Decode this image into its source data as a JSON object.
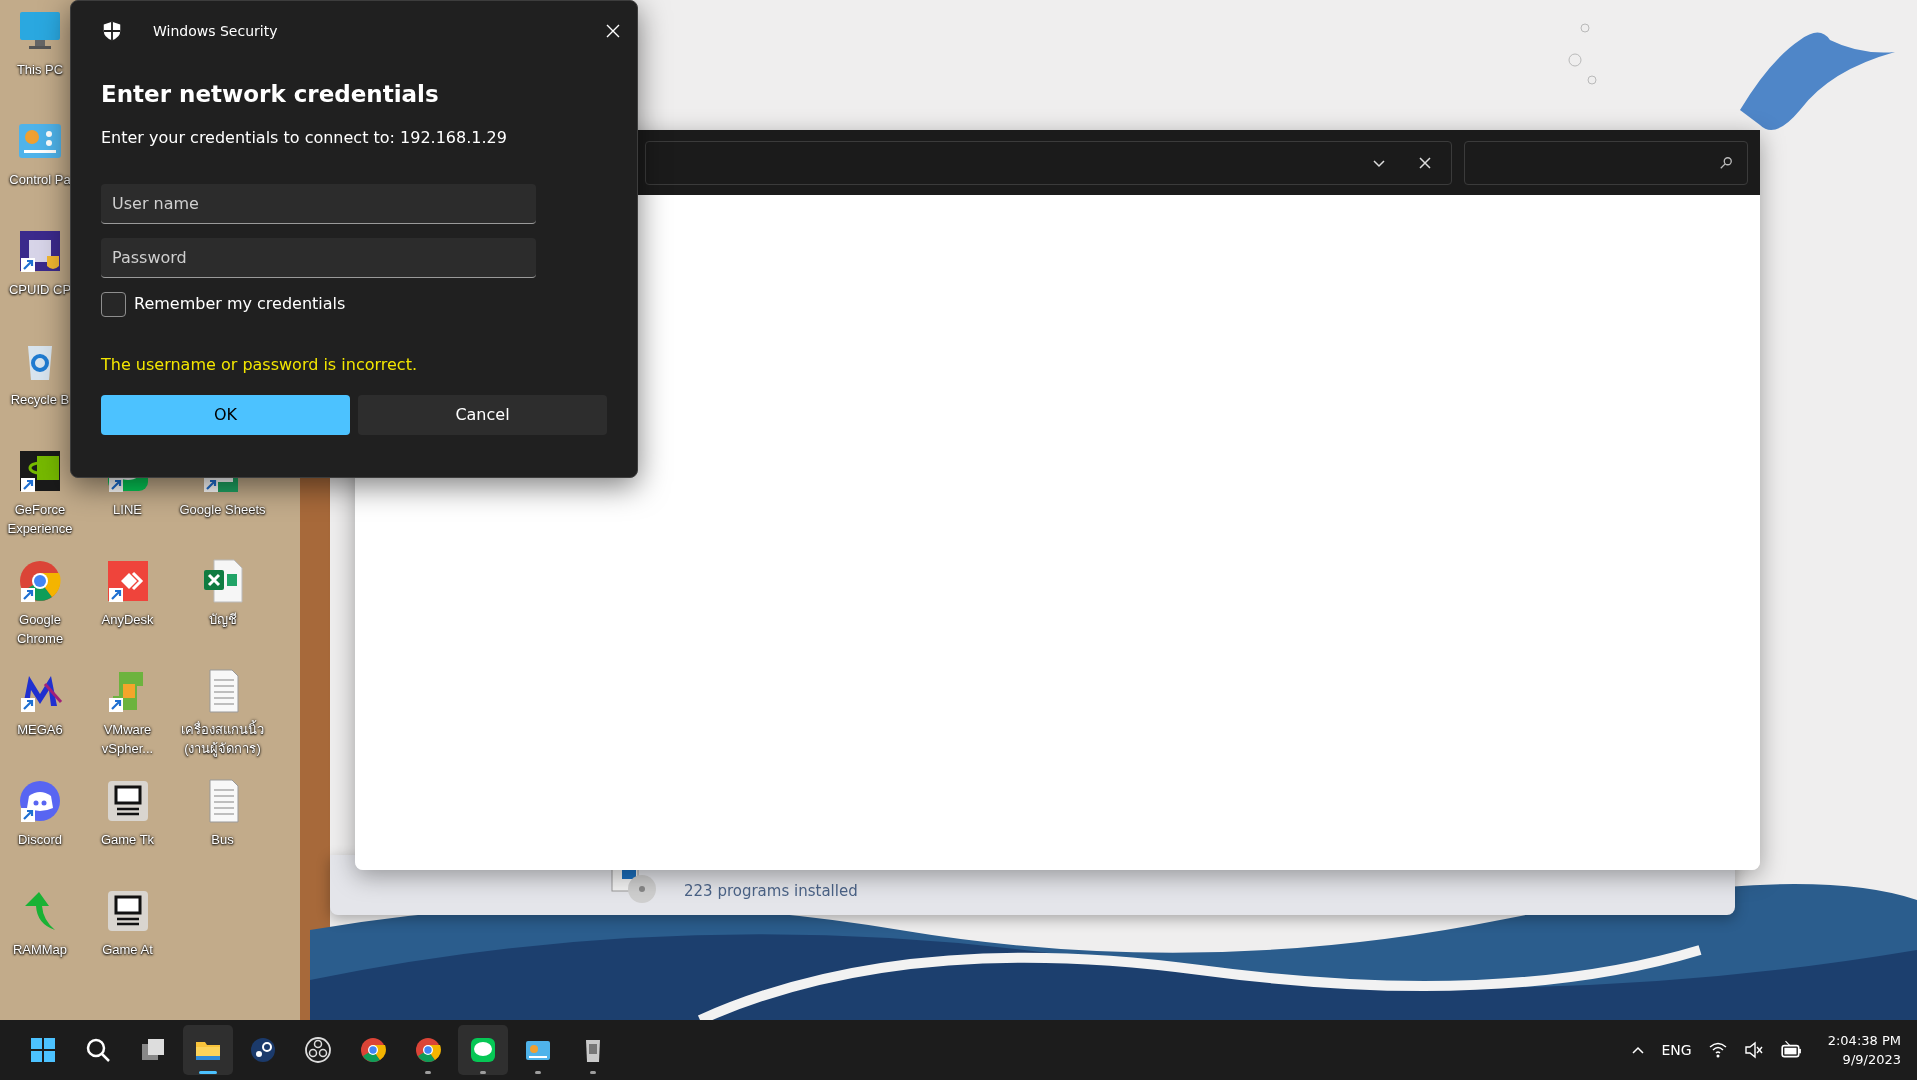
{
  "desktop_columns": [
    [
      {
        "label": "This PC",
        "kind": "monitor",
        "shortcut": false
      },
      {
        "label": "Control Pa",
        "kind": "control-panel",
        "shortcut": false
      },
      {
        "label": "CPUID CP",
        "kind": "chip",
        "shortcut": true
      },
      {
        "label": "Recycle B",
        "kind": "recycle",
        "shortcut": false
      },
      {
        "label": "GeForce Experience",
        "kind": "geforce",
        "shortcut": true
      },
      {
        "label": "Google Chrome",
        "kind": "chrome",
        "shortcut": true
      },
      {
        "label": "MEGA6",
        "kind": "mega",
        "shortcut": true
      },
      {
        "label": "Discord",
        "kind": "discord",
        "shortcut": true
      },
      {
        "label": "RAMMap",
        "kind": "arrow",
        "shortcut": false
      }
    ],
    [
      {
        "label": "LINE",
        "kind": "line",
        "shortcut": true
      },
      {
        "label": "AnyDesk",
        "kind": "anydesk",
        "shortcut": true
      },
      {
        "label": "VMware vSpher...",
        "kind": "vmware",
        "shortcut": true
      },
      {
        "label": "Game Tk",
        "kind": "terminal",
        "shortcut": false
      },
      {
        "label": "Game At",
        "kind": "terminal",
        "shortcut": false
      }
    ],
    [
      {
        "label": "Google Sheets",
        "kind": "sheets",
        "shortcut": true
      },
      {
        "label": "บัญชี",
        "kind": "excel",
        "shortcut": false
      },
      {
        "label": "เครื่องสแกนนิ้ว (งานผู้จัดการ)",
        "kind": "document",
        "shortcut": false
      },
      {
        "label": "Bus",
        "kind": "document",
        "shortcut": false
      }
    ]
  ],
  "dialog": {
    "app_title": "Windows Security",
    "heading": "Enter network credentials",
    "prompt": "Enter your credentials to connect to: 192.168.1.29",
    "fields": [
      {
        "placeholder": "User name"
      },
      {
        "placeholder": "Password"
      }
    ],
    "remember": {
      "label": "Remember my credentials",
      "checked": false
    },
    "error": "The username or password is incorrect.",
    "buttons": [
      {
        "label": "OK",
        "primary": true
      },
      {
        "label": "Cancel",
        "primary": false
      }
    ]
  },
  "explorer": {
    "status": "223 programs installed"
  },
  "taskbar": {
    "apps": [
      {
        "kind": "start",
        "running": false,
        "active": false
      },
      {
        "kind": "search",
        "running": false,
        "active": false
      },
      {
        "kind": "taskview",
        "running": false,
        "active": false
      },
      {
        "kind": "folder",
        "running": true,
        "active": true
      },
      {
        "kind": "steam",
        "running": false,
        "active": false
      },
      {
        "kind": "obs",
        "running": false,
        "active": false
      },
      {
        "kind": "chrome",
        "running": false,
        "active": false
      },
      {
        "kind": "chrome",
        "running": true,
        "active": false
      },
      {
        "kind": "line",
        "running": true,
        "active": true
      },
      {
        "kind": "control-panel",
        "running": true,
        "active": false
      },
      {
        "kind": "bin",
        "running": true,
        "active": false
      }
    ],
    "language": "ENG",
    "time": "2:04:38 PM",
    "date": "9/9/2023"
  }
}
